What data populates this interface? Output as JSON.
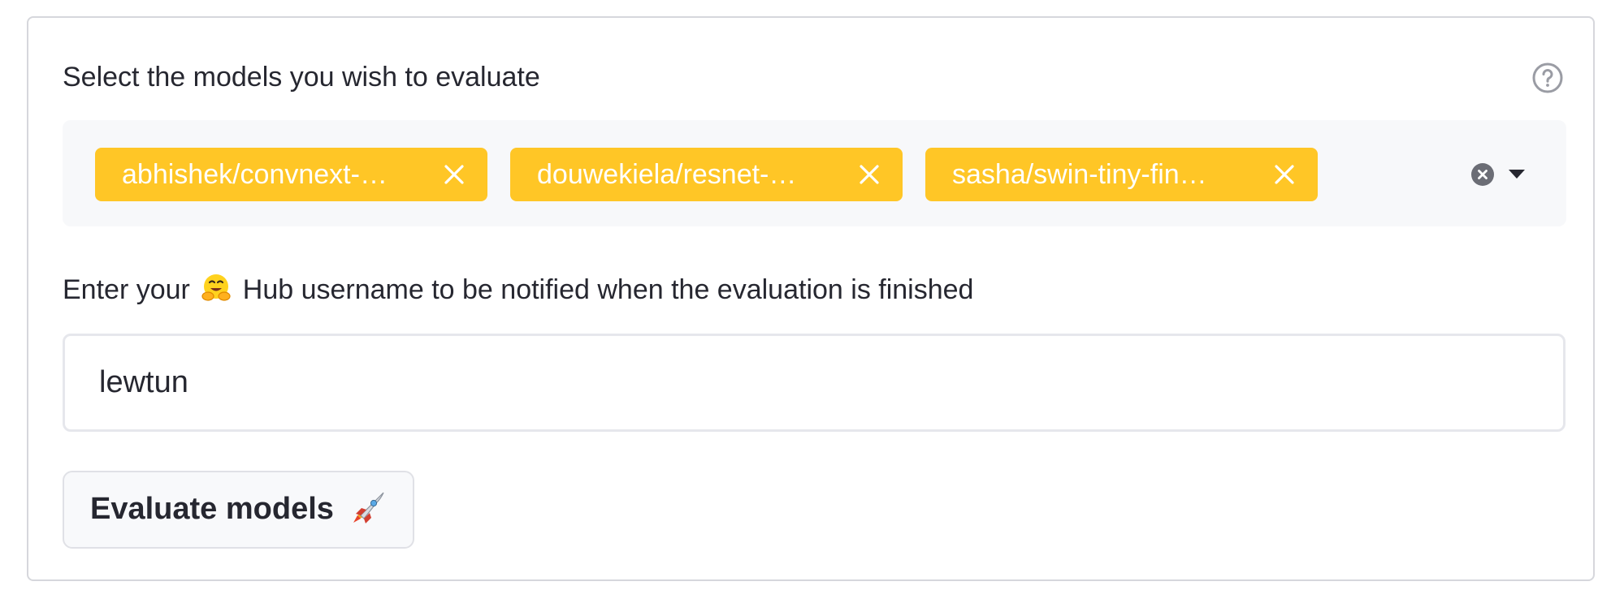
{
  "model_select": {
    "label": "Select the models you wish to evaluate",
    "help_icon": "question-circle-icon",
    "selected": [
      {
        "label": "abhishek/convnext-…",
        "remove_icon": "close-icon"
      },
      {
        "label": "douwekiela/resnet-…",
        "remove_icon": "close-icon"
      },
      {
        "label": "sasha/swin-tiny-fin…",
        "remove_icon": "close-icon"
      }
    ],
    "clear_icon": "clear-circle-icon",
    "dropdown_icon": "caret-down-icon"
  },
  "username": {
    "label_prefix": "Enter your",
    "label_emoji": "hugging-face-emoji",
    "label_suffix": "Hub username to be notified when the evaluation is finished",
    "value": "lewtun"
  },
  "submit": {
    "label": "Evaluate models",
    "icon": "rocket-emoji"
  },
  "colors": {
    "tag_bg": "#ffc626",
    "tag_text": "#ffffff",
    "panel_border": "#d6d7dc",
    "select_bg": "#f7f8fa"
  }
}
